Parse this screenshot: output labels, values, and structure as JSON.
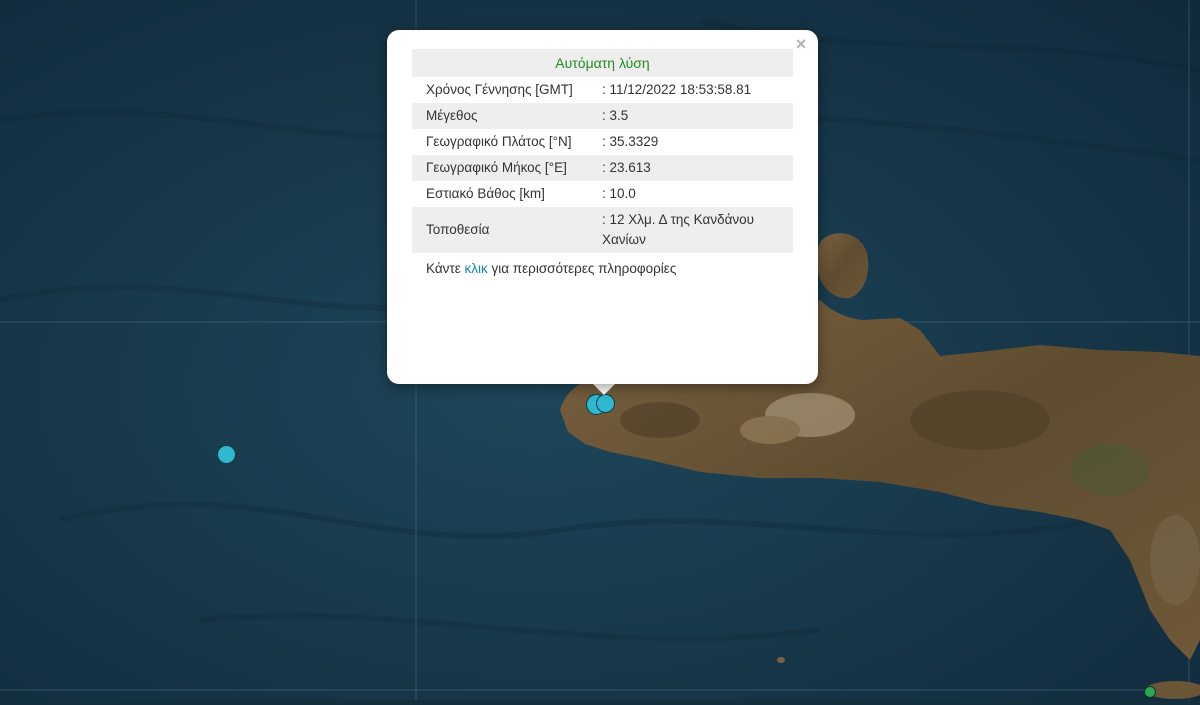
{
  "popup": {
    "title": "Αυτόματη λύση",
    "close_label": "×",
    "rows": [
      {
        "label": "Χρόνος Γέννησης [GMT]",
        "value": ": 11/12/2022 18:53:58.81"
      },
      {
        "label": "Μέγεθος",
        "value": ": 3.5"
      },
      {
        "label": "Γεωγραφικό Πλάτος [°N]",
        "value": ": 35.3329"
      },
      {
        "label": "Γεωγραφικό Μήκος [°E]",
        "value": ": 23.613"
      },
      {
        "label": "Εστιακό Βάθος [km]",
        "value": ": 10.0"
      },
      {
        "label": "Τοποθεσία",
        "value": ": 12 Χλμ. Δ της Κανδάνου Χανίων"
      }
    ],
    "footer_pre": "Κάντε ",
    "footer_link": "κλικ",
    "footer_post": " για περισσότερες πληροφορίες"
  },
  "colors": {
    "sea_deep": "#112d3c",
    "sea": "#1c4357",
    "land": "#6b5534",
    "land_light": "#8d7654",
    "marker": "#2fb8d0",
    "marker_green": "#2aa65a",
    "title_green": "#228b22",
    "link": "#1a86b8"
  }
}
